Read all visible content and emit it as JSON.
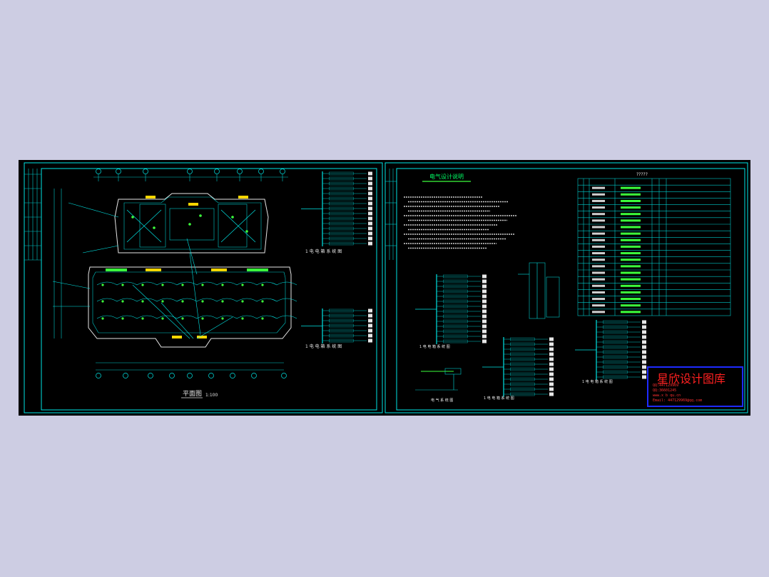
{
  "sheet_left": {
    "plan_title": "平面图",
    "plan_scale": "1:100",
    "panel_caption_top": "1 电 电 箱 系 统 图",
    "panel_caption_mid": "1 电 电 箱 系 统 图"
  },
  "sheet_right": {
    "notes_title": "电气设计说明",
    "legend_title": "?????",
    "caption_a": "1 电 电 箱 系 统 图",
    "caption_b": "1 电 电 箱 系 统 图",
    "caption_c": "1 电 电 箱 系 统 图",
    "caption_d": "电 气 系 统 图",
    "note_rows": 6,
    "legend_rows": 21
  },
  "watermark": {
    "title": "星欣设计图库",
    "line1": "QQ:447129969",
    "line2": "QQ:36601245",
    "line3": "www.x b qu.cn",
    "line4": "Email: 447129969@qq.com"
  },
  "colors": {
    "background": "#cdcde3",
    "canvas": "#000000",
    "cad_primary": "#00e5e5",
    "cad_green": "#3cff3c",
    "cad_yellow": "#ffd700",
    "watermark_red": "#ff2020",
    "watermark_border": "#1e2bff"
  }
}
